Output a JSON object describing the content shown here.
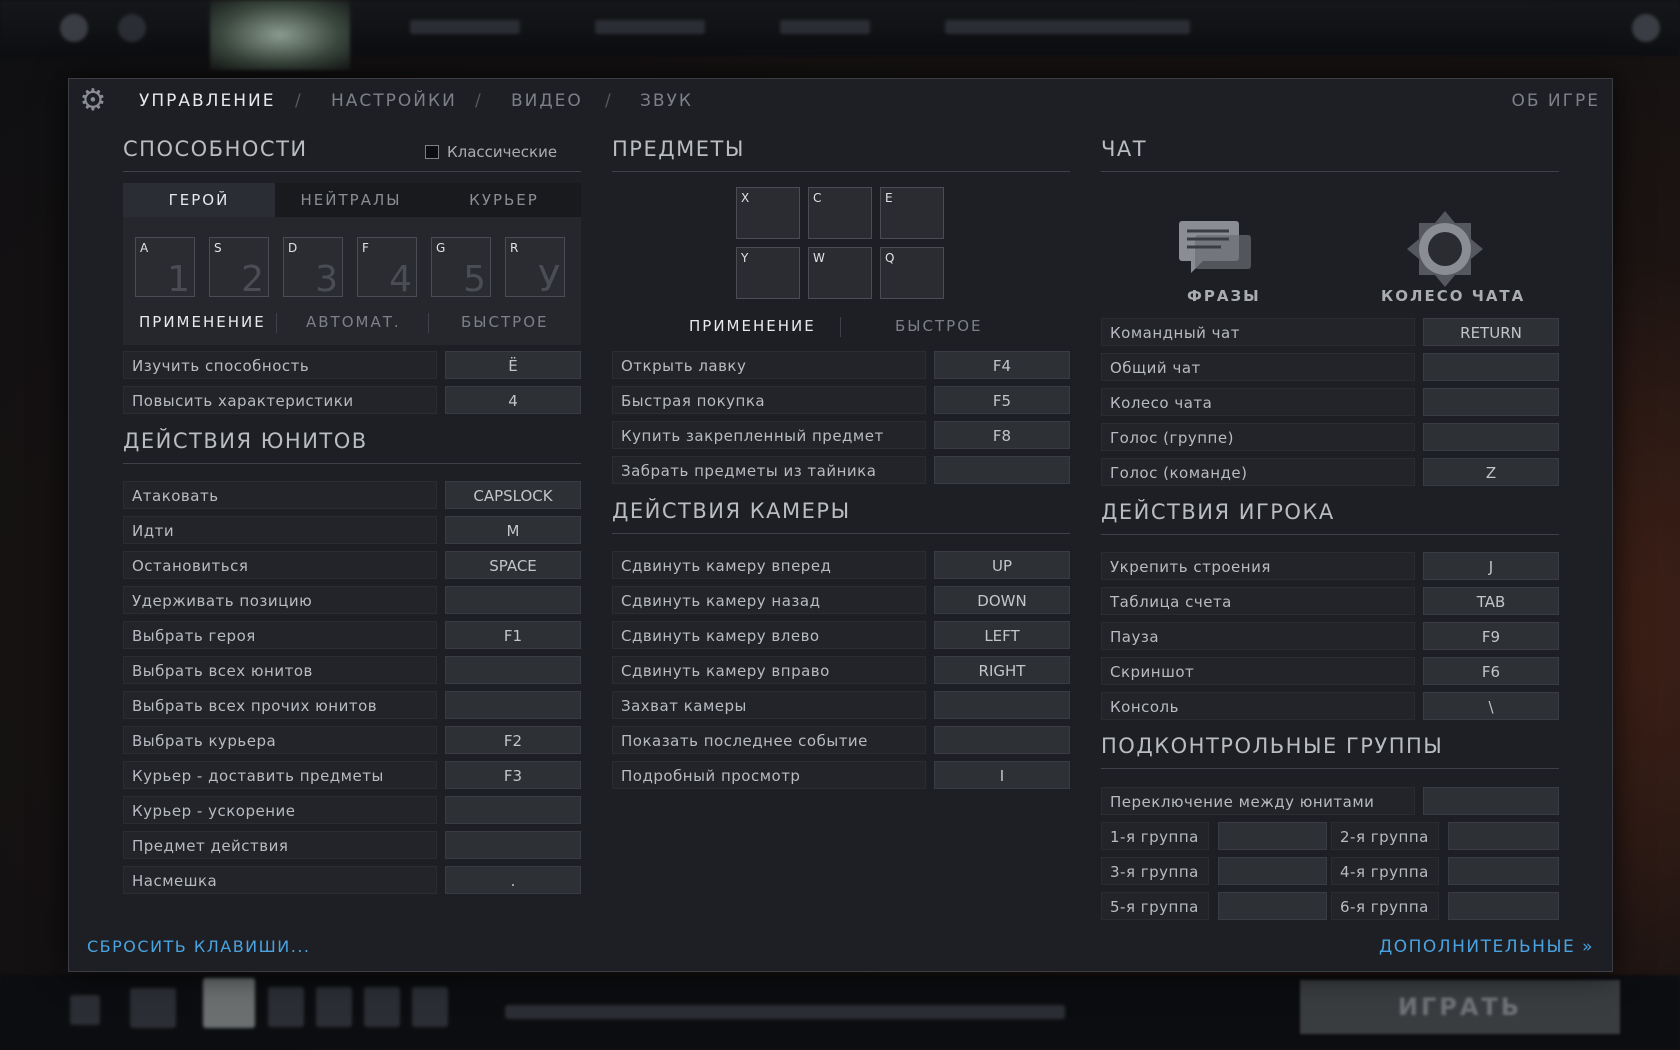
{
  "tabs": {
    "controls": "УПРАВЛЕНИЕ",
    "settings": "НАСТРОЙКИ",
    "video": "ВИДЕО",
    "sound": "ЗВУК",
    "separator": "/",
    "about": "ОБ ИГРЕ"
  },
  "abilities": {
    "title": "СПОСОБНОСТИ",
    "classic_label": "Классические",
    "classic_checked": false,
    "subtabs": [
      "ГЕРОЙ",
      "НЕЙТРАЛЫ",
      "КУРЬЕР"
    ],
    "active_subtab": 0,
    "slots": [
      {
        "key": "A",
        "num": "1"
      },
      {
        "key": "S",
        "num": "2"
      },
      {
        "key": "D",
        "num": "3"
      },
      {
        "key": "F",
        "num": "4"
      },
      {
        "key": "G",
        "num": "5"
      },
      {
        "key": "R",
        "num": "У"
      }
    ],
    "modes": [
      "ПРИМЕНЕНИЕ",
      "АВТОМАТ.",
      "БЫСТРОЕ"
    ],
    "rows": [
      {
        "label": "Изучить способность",
        "key": "Ё"
      },
      {
        "label": "Повысить характеристики",
        "key": "4"
      }
    ]
  },
  "unit_actions": {
    "title": "ДЕЙСТВИЯ ЮНИТОВ",
    "rows": [
      {
        "label": "Атаковать",
        "key": "CAPSLOCK"
      },
      {
        "label": "Идти",
        "key": "M"
      },
      {
        "label": "Остановиться",
        "key": "SPACE"
      },
      {
        "label": "Удерживать позицию",
        "key": ""
      },
      {
        "label": "Выбрать героя",
        "key": "F1"
      },
      {
        "label": "Выбрать всех юнитов",
        "key": ""
      },
      {
        "label": "Выбрать всех прочих юнитов",
        "key": ""
      },
      {
        "label": "Выбрать курьера",
        "key": "F2"
      },
      {
        "label": "Курьер - доставить предметы",
        "key": "F3"
      },
      {
        "label": "Курьер - ускорение",
        "key": ""
      },
      {
        "label": "Предмет действия",
        "key": ""
      },
      {
        "label": "Насмешка",
        "key": "."
      }
    ]
  },
  "items": {
    "title": "ПРЕДМЕТЫ",
    "slots": [
      "X",
      "C",
      "E",
      "Y",
      "W",
      "Q"
    ],
    "modes": [
      "ПРИМЕНЕНИЕ",
      "БЫСТРОЕ"
    ],
    "rows": [
      {
        "label": "Открыть лавку",
        "key": "F4"
      },
      {
        "label": "Быстрая покупка",
        "key": "F5"
      },
      {
        "label": "Купить закрепленный предмет",
        "key": "F8"
      },
      {
        "label": "Забрать предметы из тайника",
        "key": ""
      }
    ]
  },
  "camera": {
    "title": "ДЕЙСТВИЯ КАМЕРЫ",
    "rows": [
      {
        "label": "Сдвинуть камеру вперед",
        "key": "UP"
      },
      {
        "label": "Сдвинуть камеру назад",
        "key": "DOWN"
      },
      {
        "label": "Сдвинуть камеру влево",
        "key": "LEFT"
      },
      {
        "label": "Сдвинуть камеру вправо",
        "key": "RIGHT"
      },
      {
        "label": "Захват камеры",
        "key": ""
      },
      {
        "label": "Показать последнее событие",
        "key": ""
      },
      {
        "label": "Подробный просмотр",
        "key": "I"
      }
    ]
  },
  "chat": {
    "title": "ЧАТ",
    "phrases_label": "ФРАЗЫ",
    "wheel_label": "КОЛЕСО ЧАТА",
    "rows": [
      {
        "label": "Командный чат",
        "key": "RETURN"
      },
      {
        "label": "Общий чат",
        "key": ""
      },
      {
        "label": "Колесо чата",
        "key": ""
      },
      {
        "label": "Голос (группе)",
        "key": ""
      },
      {
        "label": "Голос (команде)",
        "key": "Z"
      }
    ]
  },
  "player": {
    "title": "ДЕЙСТВИЯ ИГРОКА",
    "rows": [
      {
        "label": "Укрепить строения",
        "key": "J"
      },
      {
        "label": "Таблица счета",
        "key": "TAB"
      },
      {
        "label": "Пауза",
        "key": "F9"
      },
      {
        "label": "Скриншот",
        "key": "F6"
      },
      {
        "label": "Консоль",
        "key": "\\"
      }
    ]
  },
  "groups": {
    "title": "ПОДКОНТРОЛЬНЫЕ ГРУППЫ",
    "switch_label": "Переключение между юнитами",
    "switch_key": "",
    "items": [
      {
        "label": "1-я группа",
        "key": ""
      },
      {
        "label": "2-я группа",
        "key": ""
      },
      {
        "label": "3-я группа",
        "key": ""
      },
      {
        "label": "4-я группа",
        "key": ""
      },
      {
        "label": "5-я группа",
        "key": ""
      },
      {
        "label": "6-я группа",
        "key": ""
      }
    ]
  },
  "footer": {
    "reset": "СБРОСИТЬ КЛАВИШИ...",
    "advanced": "ДОПОЛНИТЕЛЬНЫЕ »"
  },
  "background": {
    "play_button": "ИГРАТЬ"
  },
  "colors": {
    "link": "#4aa3e0",
    "panel_bg": "#1d1f24",
    "active_text": "#e8e9eb"
  },
  "icons": [
    "gear-icon",
    "phrases-icon",
    "chat-wheel-icon",
    "chevron-double-right-icon"
  ]
}
